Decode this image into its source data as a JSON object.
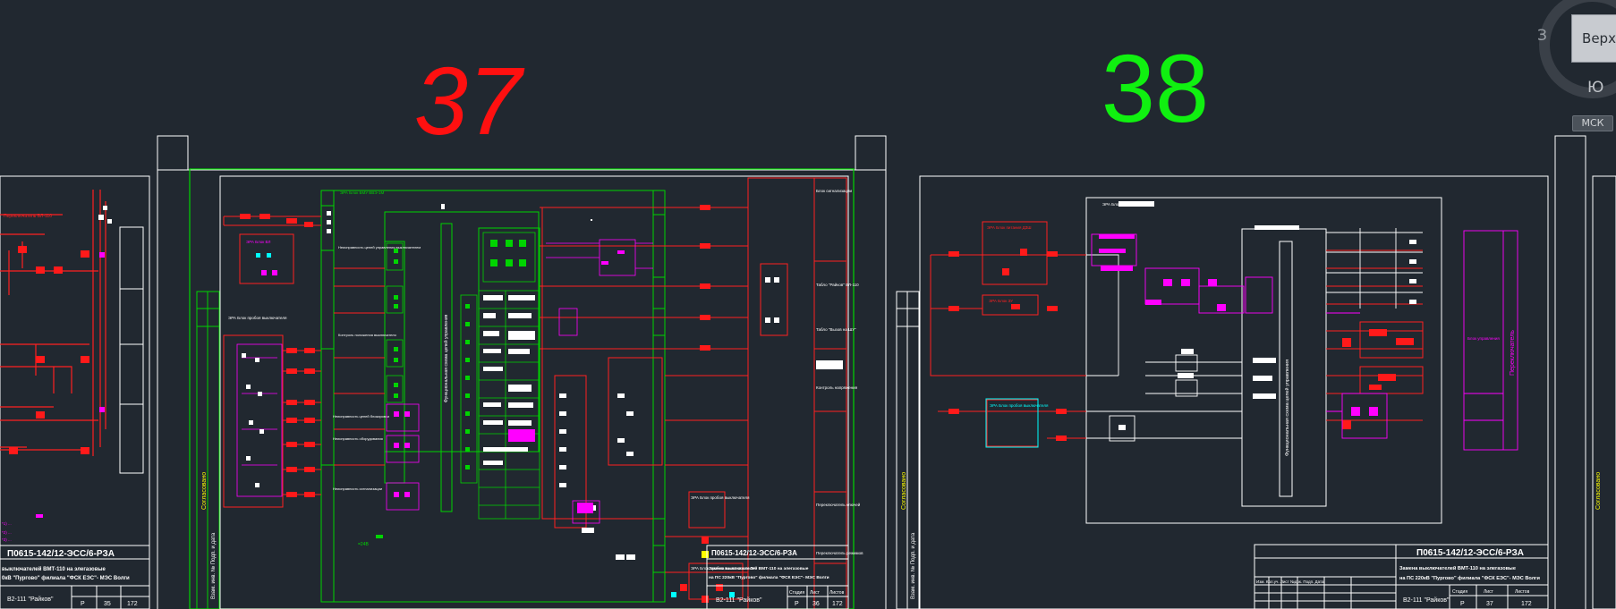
{
  "sheets": [
    {
      "number": "37",
      "color": "#ff1010",
      "doc_code": "П0615-142/12-ЭСС/6-РЗА",
      "title_line1": "Замена выключателей ВМТ-110 на элегазовые",
      "title_line2": "на ПС 220кВ \"Пургово\" филиала \"ФСК ЕЭС\"- МЭС Волги",
      "cell_label": "В2-111 \"Райков\"",
      "col_stage": "Стадия",
      "col_sheet": "Лист",
      "col_sheets": "Листов",
      "stage": "Р",
      "sheet": "36",
      "sheets_total": "172"
    },
    {
      "number": "38",
      "color": "#10f010",
      "doc_code": "П0615-142/12-ЭСС/6-РЗА",
      "title_line1": "Замена выключателей ВМТ-110 на элегазовые",
      "title_line2": "на ПС 220кВ \"Пургово\" филиала \"ФСК ЕЭС\"- МЭС Волги",
      "cell_label": "В2-111 \"Райков\"",
      "col_stage": "Стадия",
      "col_sheet": "Лист",
      "col_sheets": "Листов",
      "stage": "Р",
      "sheet": "37",
      "sheets_total": "172"
    }
  ],
  "left_partial": {
    "doc_code": "П0615-142/12-ЭСС/6-РЗА",
    "title_line1": "выключателей ВМТ-110 на элегазовые",
    "title_line2": "0кВ \"Пургово\" филиала \"ФСК ЕЭС\"- МЭС Волги",
    "cell_label": "В2-111 \"Райков\"",
    "stage": "Р",
    "sheet": "35",
    "sheets_total": "172"
  },
  "sheet37_labels": {
    "block_a": "ЭРА Блок БМУ ВВЭ-1М",
    "block_b": "ЭРА Блок пробоя выключателя",
    "block_c": "ЭРА Блок пробоя выключателя",
    "block_d": "ЭРА Блок пробоя выключателя ЗУ",
    "func1": "Неисправность цепей управления выключателем",
    "func2": "Контроль положения выключателя",
    "func3": "Неисправность цепей блокировки",
    "func4": "Неисправность оборудования",
    "func5": "Неисправность сигнализации",
    "frame_label1": "Блок сигнализации",
    "frame_label2": "Табло \"Райков\" ВЛ-110",
    "frame_label3": "Табло \"Вызов на ШУ\"",
    "frame_label4": "Контроль напряжения",
    "frame_label5": "Переключатель ключей",
    "frame_label6": "Переключатель режимов"
  },
  "sheet38_labels": {
    "block_a": "ЭРА Блок БМУ ВВЭ-1М",
    "block_b": "ЭРА Блок питания ДЗШ",
    "block_c": "ЭРА Блок ЗУ",
    "block_d": "ЭРА Блок ЗУ",
    "block_e": "ЭРА Блок пробоя выключателя",
    "vertical_text": "Функциональная схема цепей управления",
    "right_block": "Переключатель",
    "right_block2": "Блок управления"
  },
  "viewcube": {
    "top_label": "Верх",
    "west_label": "З",
    "south_label": "Ю",
    "ucs_label": "МСК"
  },
  "colors": {
    "background": "#212830",
    "frame": "#ffffff",
    "green": "#00d400",
    "red": "#ff1a1a",
    "magenta": "#ff00ff",
    "cyan": "#00ffff"
  }
}
